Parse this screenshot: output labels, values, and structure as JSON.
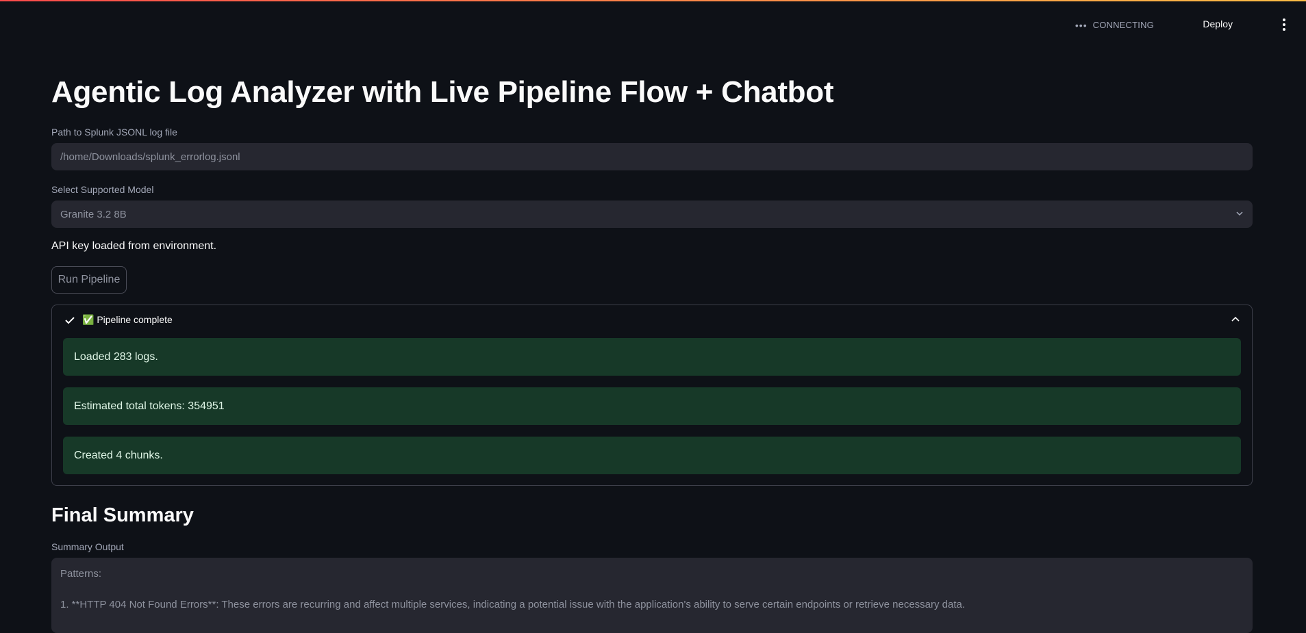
{
  "header": {
    "status_text": "CONNECTING",
    "deploy_label": "Deploy"
  },
  "main": {
    "title": "Agentic Log Analyzer with Live Pipeline Flow + Chatbot",
    "path_input": {
      "label": "Path to Splunk JSONL log file",
      "value": "/home/Downloads/splunk_errorlog.jsonl"
    },
    "model_select": {
      "label": "Select Supported Model",
      "value": "Granite 3.2 8B"
    },
    "api_status": "API key loaded from environment.",
    "run_button": "Run Pipeline",
    "expander": {
      "title": "✅ Pipeline complete",
      "messages": [
        "Loaded 283 logs.",
        "Estimated total tokens: 354951",
        "Created 4 chunks."
      ]
    },
    "summary": {
      "heading": "Final Summary",
      "label": "Summary Output",
      "lines": [
        "Patterns:",
        "1. **HTTP 404 Not Found Errors**: These errors are recurring and affect multiple services, indicating a potential issue with the application's ability to serve certain endpoints or retrieve necessary data."
      ]
    }
  },
  "colors": {
    "background": "#0e1117",
    "input_bg": "#262730",
    "success_bg": "#173928",
    "accent_gradient_start": "#ff4b4b",
    "accent_gradient_end": "#ffbd45"
  }
}
